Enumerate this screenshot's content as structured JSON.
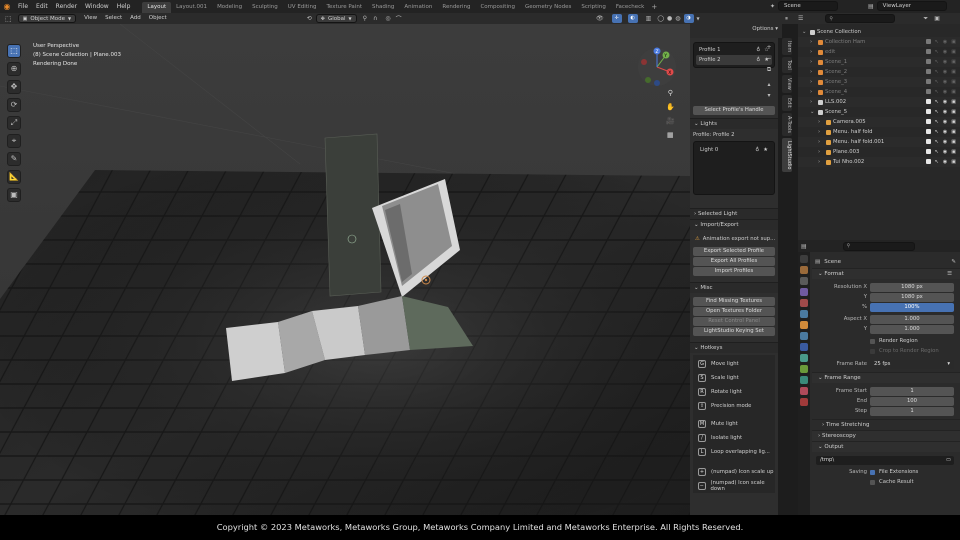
{
  "app": {
    "logo": "blender-logo-icon"
  },
  "menus": [
    "File",
    "Edit",
    "Render",
    "Window",
    "Help"
  ],
  "workspaces": [
    "Layout",
    "Layout.001",
    "Modeling",
    "Sculpting",
    "UV Editing",
    "Texture Paint",
    "Shading",
    "Animation",
    "Rendering",
    "Compositing",
    "Geometry Nodes",
    "Scripting",
    "Facecheck"
  ],
  "active_workspace": "Layout",
  "add_tab": "+",
  "scene_name": "Scene",
  "view_layer": "ViewLayer",
  "header": {
    "mode": "Object Mode",
    "menus": [
      "View",
      "Select",
      "Add",
      "Object"
    ],
    "orientation": "Global",
    "options": "Options"
  },
  "viewport": {
    "info": [
      "User Perspective",
      "(8) Scene Collection | Plane.003",
      "Rendering Done"
    ],
    "gizmo": {
      "x": "X",
      "y": "Y",
      "z": "Z"
    }
  },
  "tools": [
    "select",
    "cursor",
    "move",
    "rotate",
    "scale",
    "transform",
    "annotate",
    "measure",
    "add-cube"
  ],
  "npanel": {
    "tabs": [
      "Item",
      "Tool",
      "View",
      "Edit",
      "A-Tools",
      "LightStudio"
    ],
    "active_tab": "LightStudio",
    "profiles": [
      "Profile 1",
      "Profile 2"
    ],
    "select_handle": "Select Profile's Handle",
    "lights_header": "Lights",
    "profile_label": "Profile: Profile 2",
    "lights": [
      "Light 0"
    ],
    "selected_light": "Selected Light",
    "import_export": "Import/Export",
    "anim_warning": "Animation export not sup...",
    "ie_buttons": [
      "Export Selected Profile",
      "Export All Profiles",
      "Import Profiles"
    ],
    "misc": "Misc",
    "misc_buttons": [
      "Find Missing Textures",
      "Open Textures Folder",
      "Reset Control Panel",
      "LightStudio Keying Set"
    ],
    "hotkeys": "Hotkeys",
    "hotkey_items": [
      {
        "key": "G",
        "label": "Move light"
      },
      {
        "key": "S",
        "label": "Scale light"
      },
      {
        "key": "R",
        "label": "Rotate light"
      },
      {
        "key": "⇧",
        "label": "Precision mode"
      },
      {
        "key": "M",
        "label": "Mute light"
      },
      {
        "key": "/",
        "label": "Isolate light"
      },
      {
        "key": "L",
        "label": "Loop overlapping lig..."
      },
      {
        "key": "+",
        "label": "(numpad) Icon scale up"
      },
      {
        "key": "−",
        "label": "(numpad) Icon scale down"
      }
    ]
  },
  "outliner": {
    "items": [
      {
        "name": "Scene Collection",
        "indent": 0,
        "dim": false
      },
      {
        "name": "Collection Ham",
        "indent": 1,
        "dim": true
      },
      {
        "name": "edit",
        "indent": 1,
        "dim": true
      },
      {
        "name": "Scene_1",
        "indent": 1,
        "dim": true
      },
      {
        "name": "Scene_2",
        "indent": 1,
        "dim": true
      },
      {
        "name": "Scene_3",
        "indent": 1,
        "dim": true
      },
      {
        "name": "Scene_4",
        "indent": 1,
        "dim": true
      },
      {
        "name": "LLS.002",
        "indent": 1,
        "dim": false
      },
      {
        "name": "Scene_5",
        "indent": 1,
        "dim": false
      },
      {
        "name": "Camera.005",
        "indent": 2,
        "dim": false
      },
      {
        "name": "Menu. half fold",
        "indent": 2,
        "dim": false
      },
      {
        "name": "Menu. half fold.001",
        "indent": 2,
        "dim": false
      },
      {
        "name": "Plane.003",
        "indent": 2,
        "dim": false
      },
      {
        "name": "Tui Nho.002",
        "indent": 2,
        "dim": false
      }
    ]
  },
  "properties": {
    "scene_label": "Scene",
    "format": "Format",
    "res_x_label": "Resolution X",
    "res_x": "1080 px",
    "y_label": "Y",
    "res_y": "1080 px",
    "pct_label": "%",
    "pct": "100%",
    "aspect_x_label": "Aspect X",
    "aspect_x": "1.000",
    "aspect_y": "1.000",
    "render_region": "Render Region",
    "crop_region": "Crop to Render Region",
    "frame_rate_label": "Frame Rate",
    "frame_rate": "25 fps",
    "frame_range": "Frame Range",
    "frame_start_label": "Frame Start",
    "frame_start": "1",
    "end_label": "End",
    "end": "100",
    "step_label": "Step",
    "step": "1",
    "time_stretching": "Time Stretching",
    "stereoscopy": "Stereoscopy",
    "output": "Output",
    "output_path": "/tmp\\",
    "saving_label": "Saving",
    "file_ext": "File Extensions",
    "cache_result": "Cache Result"
  },
  "colors": {
    "accent": "#4772b3",
    "bg": "#1d1d1d",
    "panel": "#2e2e2e"
  },
  "footer": "Copyright © 2023 Metaworks, Metaworks Group, Metaworks Company Limited and Metaworks Enterprise. All Rights Reserved."
}
